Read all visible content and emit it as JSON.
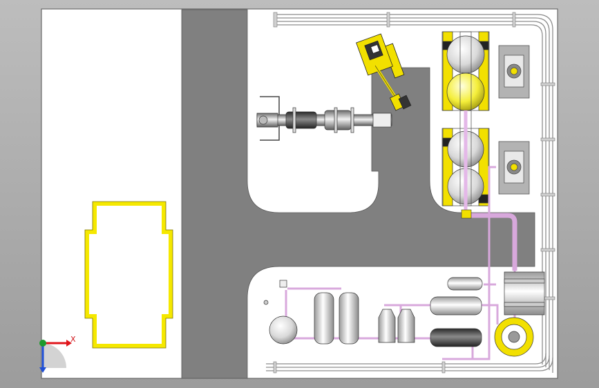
{
  "viewport": {
    "title": "",
    "colors": {
      "background": "#a8a8a8",
      "sheet": "#ffffff",
      "road": "#808080",
      "yellow": "#ffee00",
      "pipe": "#d8a8dc",
      "tank": "#e8e8e8",
      "dark_tank": "#505050"
    }
  },
  "triad": {
    "x_label": "X",
    "x_color": "#e0151b",
    "y_color": "#1d9a2d",
    "z_color": "#1f4fd6"
  },
  "components": {
    "excavator": "excavator",
    "conveyor_shaft": "rotary-shaft",
    "outline_frame": "yellow-outline-frame",
    "spherical_tanks": "spherical-tank-stack",
    "valves": "valve-block",
    "pipe_network": "pipe-network",
    "vessels": "pressure-vessels",
    "ring_unit": "yellow-ring-unit"
  }
}
